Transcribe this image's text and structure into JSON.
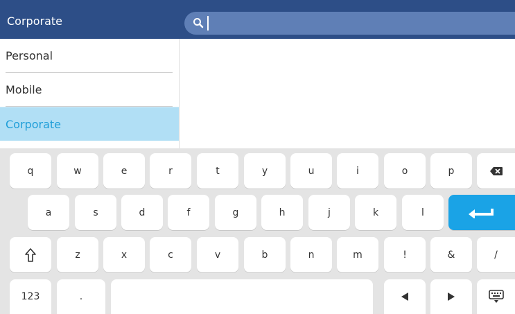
{
  "header": {
    "title": "Corporate",
    "search": {
      "value": "",
      "icon": "search-icon"
    }
  },
  "folders": [
    {
      "label": "Personal",
      "selected": false
    },
    {
      "label": "Mobile",
      "selected": false
    },
    {
      "label": "Corporate",
      "selected": true
    }
  ],
  "keyboard": {
    "row1": [
      "q",
      "w",
      "e",
      "r",
      "t",
      "y",
      "u",
      "i",
      "o",
      "p"
    ],
    "row2": [
      "a",
      "s",
      "d",
      "f",
      "g",
      "h",
      "j",
      "k",
      "l"
    ],
    "row3": [
      "z",
      "x",
      "c",
      "v",
      "b",
      "n",
      "m",
      "!",
      "&",
      "/"
    ],
    "row4": {
      "numbers": "123",
      "period": "."
    },
    "icons": {
      "backspace": "backspace-icon",
      "enter": "enter-icon",
      "shift": "shift-icon",
      "left": "arrow-left-icon",
      "right": "arrow-right-icon",
      "keyboard": "keyboard-icon"
    }
  },
  "colors": {
    "header_bg": "#2d4e87",
    "search_bg": "#5f7fb6",
    "selected_bg": "#b1dff5",
    "selected_text": "#1f9ed8",
    "enter_key": "#1aa3e6",
    "keyboard_bg": "#e4e4e4"
  }
}
